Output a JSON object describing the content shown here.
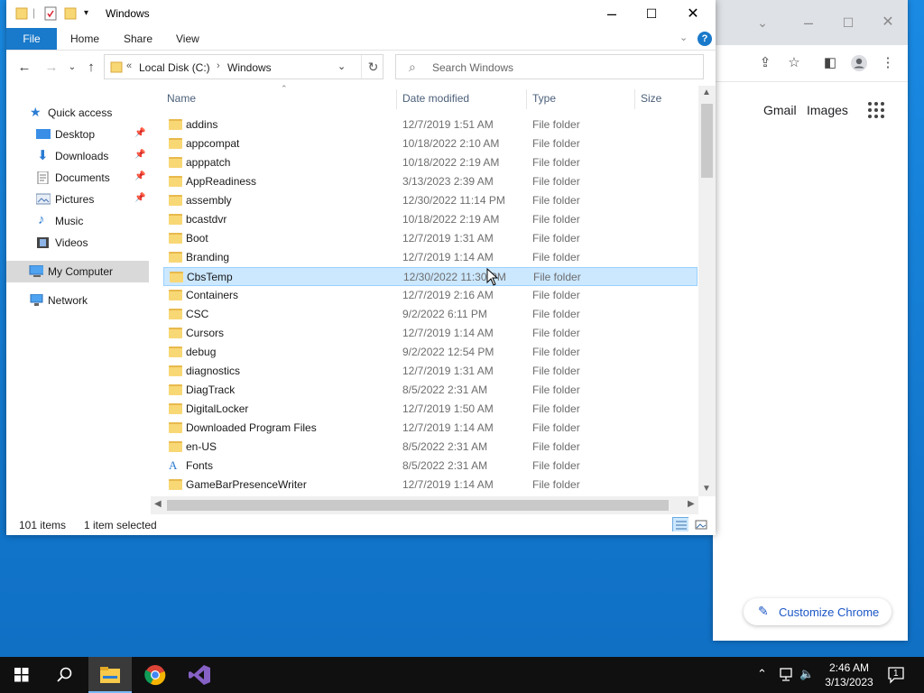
{
  "explorer": {
    "title": "Windows",
    "ribbon": {
      "file": "File",
      "home": "Home",
      "share": "Share",
      "view": "View",
      "help": "?"
    },
    "address": {
      "prefix": "«",
      "crumbs": [
        "Local Disk (C:)",
        "Windows"
      ]
    },
    "search_placeholder": "Search Windows",
    "nav": {
      "quick_access": "Quick access",
      "desktop": "Desktop",
      "downloads": "Downloads",
      "documents": "Documents",
      "pictures": "Pictures",
      "music": "Music",
      "videos": "Videos",
      "my_computer": "My Computer",
      "network": "Network"
    },
    "columns": {
      "name": "Name",
      "date": "Date modified",
      "type": "Type",
      "size": "Size"
    },
    "files": [
      {
        "name": "addins",
        "date": "12/7/2019 1:51 AM",
        "type": "File folder"
      },
      {
        "name": "appcompat",
        "date": "10/18/2022 2:10 AM",
        "type": "File folder"
      },
      {
        "name": "apppatch",
        "date": "10/18/2022 2:19 AM",
        "type": "File folder"
      },
      {
        "name": "AppReadiness",
        "date": "3/13/2023 2:39 AM",
        "type": "File folder"
      },
      {
        "name": "assembly",
        "date": "12/30/2022 11:14 PM",
        "type": "File folder"
      },
      {
        "name": "bcastdvr",
        "date": "10/18/2022 2:19 AM",
        "type": "File folder"
      },
      {
        "name": "Boot",
        "date": "12/7/2019 1:31 AM",
        "type": "File folder"
      },
      {
        "name": "Branding",
        "date": "12/7/2019 1:14 AM",
        "type": "File folder"
      },
      {
        "name": "CbsTemp",
        "date": "12/30/2022 11:30 PM",
        "type": "File folder"
      },
      {
        "name": "Containers",
        "date": "12/7/2019 2:16 AM",
        "type": "File folder"
      },
      {
        "name": "CSC",
        "date": "9/2/2022 6:11 PM",
        "type": "File folder"
      },
      {
        "name": "Cursors",
        "date": "12/7/2019 1:14 AM",
        "type": "File folder"
      },
      {
        "name": "debug",
        "date": "9/2/2022 12:54 PM",
        "type": "File folder"
      },
      {
        "name": "diagnostics",
        "date": "12/7/2019 1:31 AM",
        "type": "File folder"
      },
      {
        "name": "DiagTrack",
        "date": "8/5/2022 2:31 AM",
        "type": "File folder"
      },
      {
        "name": "DigitalLocker",
        "date": "12/7/2019 1:50 AM",
        "type": "File folder"
      },
      {
        "name": "Downloaded Program Files",
        "date": "12/7/2019 1:14 AM",
        "type": "File folder"
      },
      {
        "name": "en-US",
        "date": "8/5/2022 2:31 AM",
        "type": "File folder"
      },
      {
        "name": "Fonts",
        "date": "8/5/2022 2:31 AM",
        "type": "File folder"
      },
      {
        "name": "GameBarPresenceWriter",
        "date": "12/7/2019 1:14 AM",
        "type": "File folder"
      }
    ],
    "status": {
      "count": "101 items",
      "selected": "1 item selected"
    }
  },
  "chrome": {
    "gmail": "Gmail",
    "images": "Images",
    "customize": "Customize Chrome"
  },
  "taskbar": {
    "time": "2:46 AM",
    "date": "3/13/2023",
    "notifications": "1"
  },
  "colors": {
    "accent": "#1979ca",
    "selection": "#cce8ff",
    "folder": "#f8d775",
    "taskbar": "#101010"
  }
}
